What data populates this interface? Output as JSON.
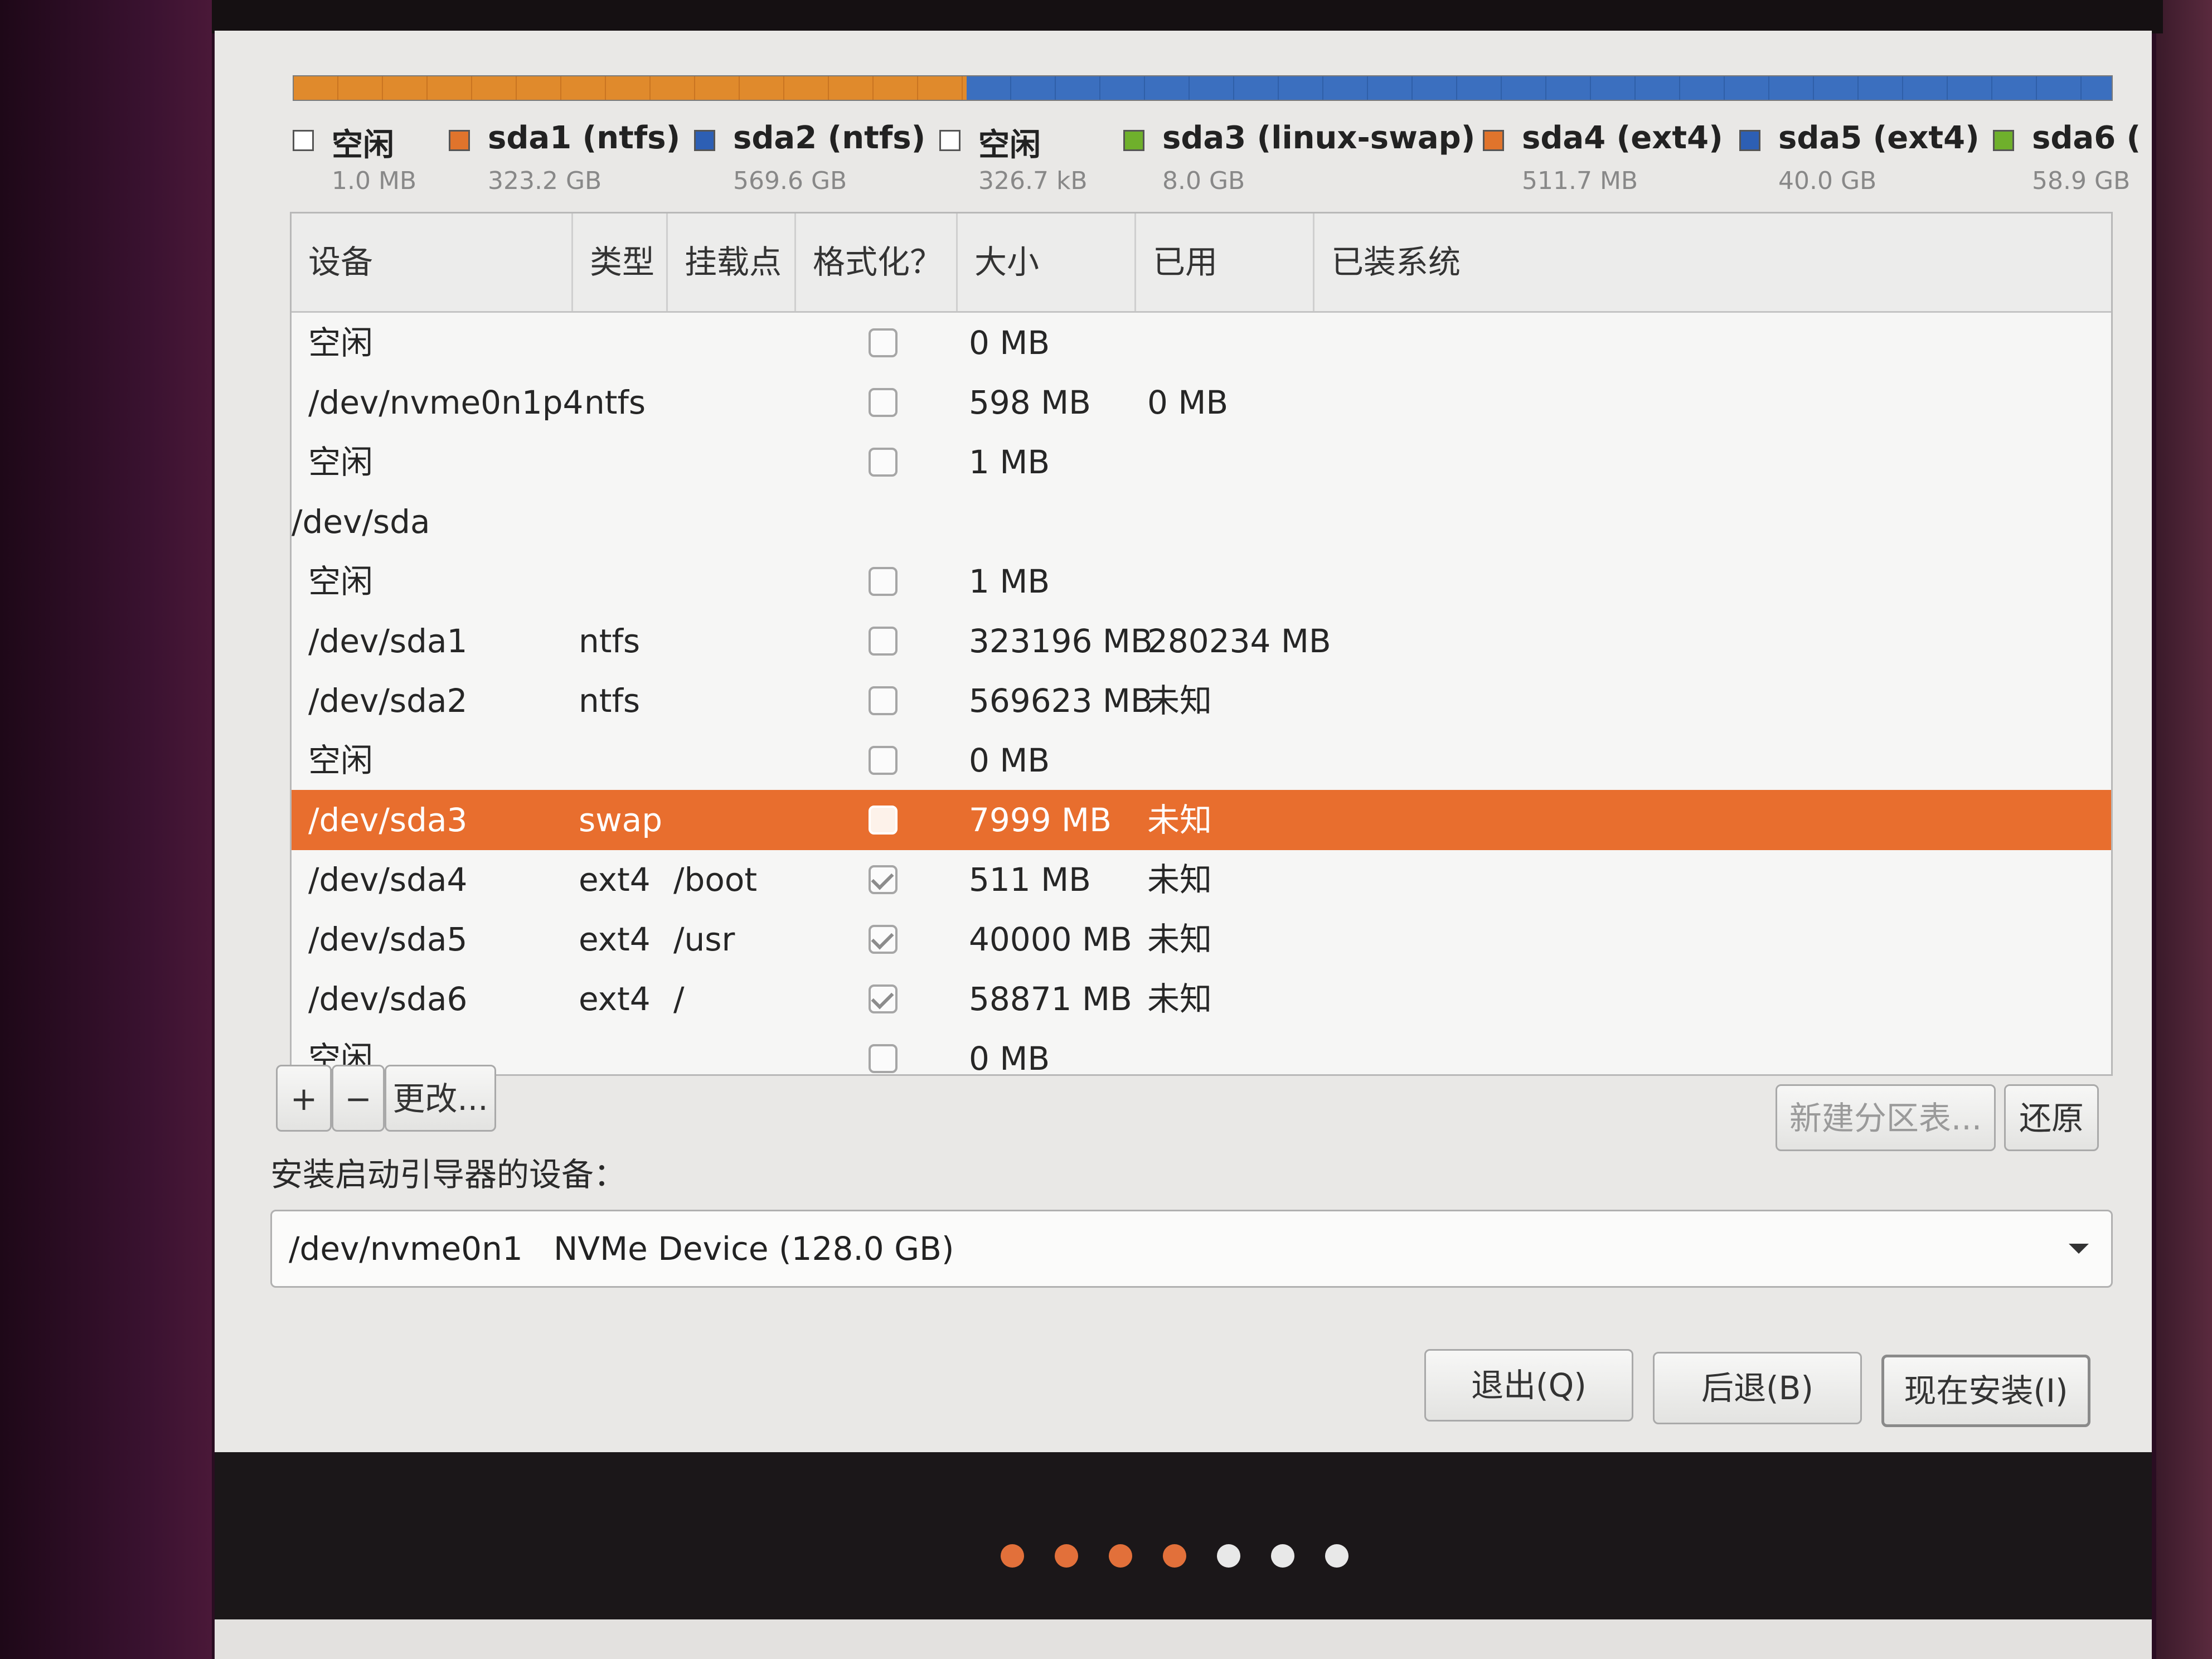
{
  "partition_legend": [
    {
      "name": "空闲",
      "size": "1.0 MB",
      "color": "#ffffff"
    },
    {
      "name": "sda1 (ntfs)",
      "size": "323.2 GB",
      "color": "#e0742c"
    },
    {
      "name": "sda2 (ntfs)",
      "size": "569.6 GB",
      "color": "#2d5fb4"
    },
    {
      "name": "空闲",
      "size": "326.7 kB",
      "color": "#ffffff"
    },
    {
      "name": "sda3 (linux-swap)",
      "size": "8.0 GB",
      "color": "#6fb02c"
    },
    {
      "name": "sda4 (ext4)",
      "size": "511.7 MB",
      "color": "#e0742c"
    },
    {
      "name": "sda5 (ext4)",
      "size": "40.0 GB",
      "color": "#2d5fb4"
    },
    {
      "name": "sda6 (",
      "size": "58.9 GB",
      "color": "#6fb02c"
    }
  ],
  "table": {
    "columns": [
      "设备",
      "类型",
      "挂载点",
      "格式化？",
      "大小",
      "已用",
      "已装系统"
    ],
    "rows": [
      {
        "device": "空闲",
        "type": "",
        "mount": "",
        "format": false,
        "show_cb": true,
        "size": "0 MB",
        "used": "",
        "selected": false
      },
      {
        "device": "/dev/nvme0n1p4",
        "type": "ntfs",
        "mount": "",
        "format": false,
        "show_cb": true,
        "size": "598 MB",
        "used": "0 MB",
        "selected": false
      },
      {
        "device": "空闲",
        "type": "",
        "mount": "",
        "format": false,
        "show_cb": true,
        "size": "1 MB",
        "used": "",
        "selected": false
      },
      {
        "device": "/dev/sda",
        "type": "",
        "mount": "",
        "format": false,
        "show_cb": false,
        "size": "",
        "used": "",
        "selected": false,
        "is_disk": true
      },
      {
        "device": "空闲",
        "type": "",
        "mount": "",
        "format": false,
        "show_cb": true,
        "size": "1 MB",
        "used": "",
        "selected": false
      },
      {
        "device": "/dev/sda1",
        "type": "ntfs",
        "mount": "",
        "format": false,
        "show_cb": true,
        "size": "323196 MB",
        "used": "280234 MB",
        "selected": false
      },
      {
        "device": "/dev/sda2",
        "type": "ntfs",
        "mount": "",
        "format": false,
        "show_cb": true,
        "size": "569623 MB",
        "used": "未知",
        "selected": false
      },
      {
        "device": "空闲",
        "type": "",
        "mount": "",
        "format": false,
        "show_cb": true,
        "size": "0 MB",
        "used": "",
        "selected": false
      },
      {
        "device": "/dev/sda3",
        "type": "swap",
        "mount": "",
        "format": false,
        "show_cb": true,
        "size": "7999 MB",
        "used": "未知",
        "selected": true
      },
      {
        "device": "/dev/sda4",
        "type": "ext4",
        "mount": "/boot",
        "format": true,
        "show_cb": true,
        "size": "511 MB",
        "used": "未知",
        "selected": false
      },
      {
        "device": "/dev/sda5",
        "type": "ext4",
        "mount": "/usr",
        "format": true,
        "show_cb": true,
        "size": "40000 MB",
        "used": "未知",
        "selected": false
      },
      {
        "device": "/dev/sda6",
        "type": "ext4",
        "mount": "/",
        "format": true,
        "show_cb": true,
        "size": "58871 MB",
        "used": "未知",
        "selected": false
      },
      {
        "device": "空闲",
        "type": "",
        "mount": "",
        "format": false,
        "show_cb": true,
        "size": "0 MB",
        "used": "",
        "selected": false
      }
    ]
  },
  "toolbar": {
    "add_label": "+",
    "remove_label": "−",
    "change_label": "更改...",
    "new_table_label": "新建分区表...",
    "revert_label": "还原"
  },
  "bootloader": {
    "label": "安装启动引导器的设备：",
    "device": "/dev/nvme0n1",
    "description": "NVMe Device (128.0 GB)"
  },
  "actions": {
    "quit_label": "退出(Q)",
    "back_label": "后退(B)",
    "install_label": "现在安装(I)"
  },
  "progress": {
    "total_steps": 7,
    "completed_steps": 4,
    "active_color": "#e2703a",
    "inactive_color": "#e8e8e8"
  }
}
